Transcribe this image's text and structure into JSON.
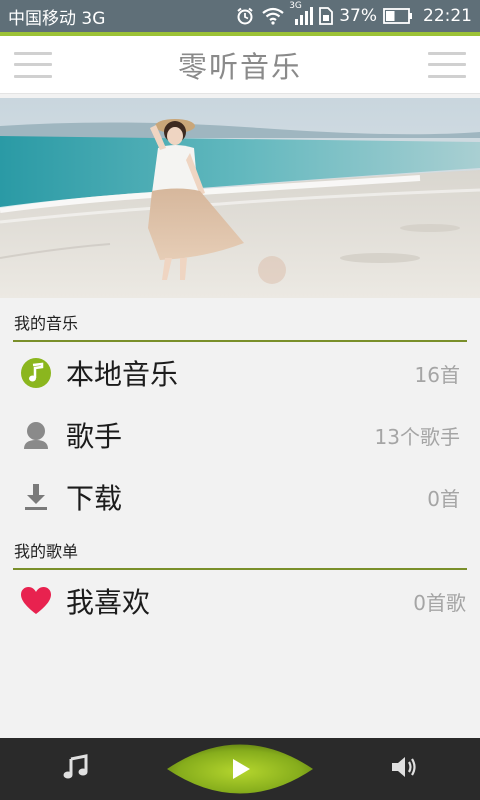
{
  "status_bar": {
    "carrier": "中国移动 3G",
    "network_small": "3G",
    "battery_percent": "37%",
    "time": "22:21"
  },
  "header": {
    "title": "零听音乐"
  },
  "sections": [
    {
      "title": "我的音乐",
      "items": [
        {
          "label": "本地音乐",
          "count": "16首",
          "icon": "music-note-icon"
        },
        {
          "label": "歌手",
          "count": "13个歌手",
          "icon": "singer-icon"
        },
        {
          "label": "下载",
          "count": "0首",
          "icon": "download-icon"
        }
      ]
    },
    {
      "title": "我的歌单",
      "items": [
        {
          "label": "我喜欢",
          "count": "0首歌",
          "icon": "heart-icon"
        }
      ]
    }
  ],
  "colors": {
    "accent_green": "#9cc236",
    "section_line": "#7a8f2a",
    "heart": "#e8224f",
    "status_bar": "#5f6f78"
  }
}
